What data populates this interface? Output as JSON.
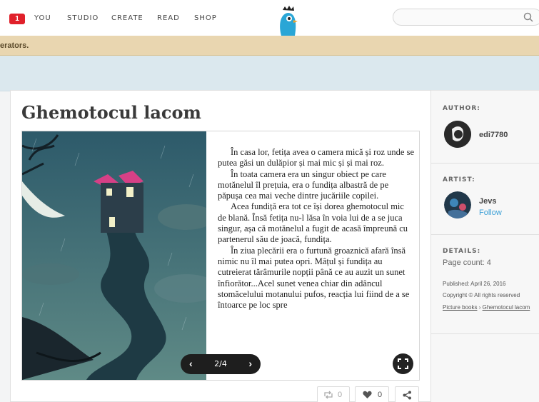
{
  "nav": {
    "notification_count": "1",
    "items": [
      "YOU",
      "STUDIO",
      "CREATE",
      "READ",
      "SHOP"
    ]
  },
  "banner": {
    "text": "erators."
  },
  "book": {
    "title": "Ghemotocul lacom",
    "paragraphs": [
      "În casa lor, fetița avea o camera mică și roz unde se putea găsi un dulăpior și mai mic și și mai roz.",
      "În toata camera era un singur obiect pe care motănelul îl prețuia, era o fundița albastră de pe păpușa cea mai veche dintre jucăriile copilei.",
      "Acea fundiță era tot ce își dorea ghemotocul mic de blană. Însă fetița nu-l lăsa în voia lui de a se juca singur, așa că motănelul a fugit de acasă împreună cu partenerul său de joacă, fundița.",
      "În ziua plecării era o furtună groaznică afară însă nimic nu îl mai putea opri. Mâțul și fundița au cutreierat tărâmurile nopții până ce au auzit un sunet înfiorător...Acel sunet venea chiar din adâncul stomăcelului motanului pufos, reacția lui fiind de a se întoarce pe loc spre"
    ],
    "pager": {
      "current": "2",
      "total": "4",
      "separator": "/"
    },
    "actions": {
      "remix_count": "0",
      "likes": "0"
    }
  },
  "sidebar": {
    "author_label": "AUTHOR:",
    "author_name": "edi7780",
    "artist_label": "ARTIST:",
    "artist_name": "Jevs",
    "follow_label": "Follow",
    "details_label": "DETAILS:",
    "page_count": "Page count: 4",
    "published": "Published: April 26, 2016",
    "copyright": "Copyright © All rights reserved",
    "breadcrumb_category": "Picture books",
    "breadcrumb_sep": "›",
    "breadcrumb_title": "Ghemotocul lacom"
  },
  "colors": {
    "accent": "#3a9fd6",
    "notification": "#e0202a",
    "banner": "#e9d6b0"
  }
}
